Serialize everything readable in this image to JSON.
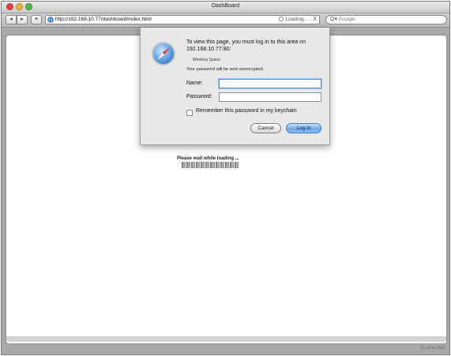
{
  "window": {
    "title": "DashBoard"
  },
  "toolbar": {
    "back_icon": "back-icon",
    "forward_icon": "forward-icon",
    "add_bookmark_label": "+",
    "url": "http://192.168.10.77/dashboard/index.html",
    "load_status": "Loading...",
    "stop_label": "X",
    "search_placeholder": "Google",
    "search_icon": "search-icon"
  },
  "page": {
    "loading_text": "Please wait while loading ...",
    "copyright": "© LaCie 2010"
  },
  "auth_dialog": {
    "icon": "safari-compass-icon",
    "message": "To view this page, you must log in to this area on 192.168.10.77:80:",
    "realm": "Wireless Space",
    "warning": "Your password will be sent unencrypted.",
    "name_label": "Name:",
    "name_value": "",
    "password_label": "Password:",
    "password_value": "",
    "remember_label": "Remember this password in my keychain",
    "remember_checked": false,
    "cancel_label": "Cancel",
    "login_label": "Log In"
  },
  "colors": {
    "window_chrome": "#a9a9a9",
    "focus_ring": "#5b8fd6",
    "default_button": "#6fa9e8"
  }
}
